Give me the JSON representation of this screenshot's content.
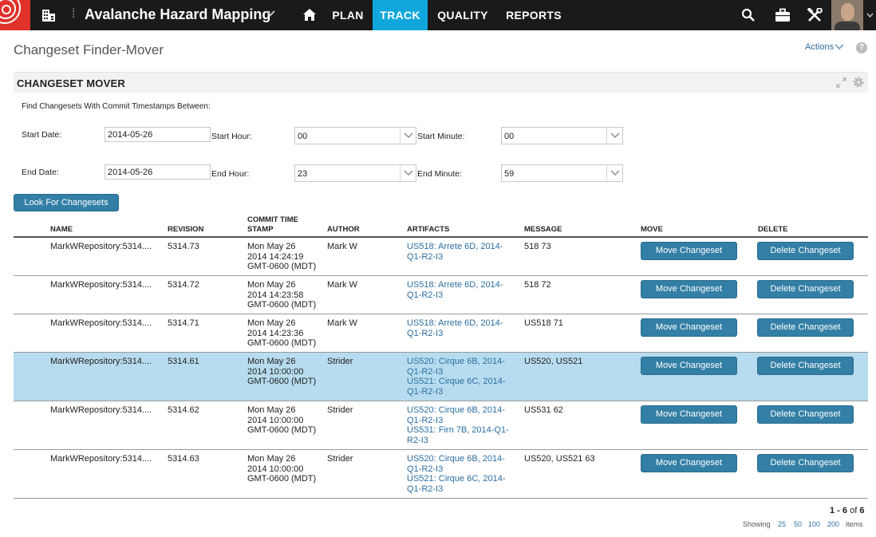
{
  "app": {
    "project_title": "Avalanche Hazard Mapping",
    "nav_tabs": [
      {
        "label": "PLAN",
        "active": false
      },
      {
        "label": "TRACK",
        "active": true
      },
      {
        "label": "QUALITY",
        "active": false
      },
      {
        "label": "REPORTS",
        "active": false
      }
    ],
    "colors": {
      "topbar": "#1a1a1a",
      "logo": "#e0312b",
      "active_tab": "#11a7dc",
      "button": "#337fa6",
      "link": "#2c6ea1",
      "selected_row": "#b7dcef"
    }
  },
  "page": {
    "title": "Changeset Finder-Mover",
    "actions_label": "Actions",
    "help_label": "?"
  },
  "panel": {
    "title": "CHANGESET MOVER",
    "find_label": "Find Changesets With Commit Timestamps Between:",
    "start_date_label": "Start Date:",
    "start_date": "2014-05-26",
    "start_hour_label": "Start Hour:",
    "start_hour": "00",
    "start_minute_label": "Start Minute:",
    "start_minute": "00",
    "end_date_label": "End Date:",
    "end_date": "2014-05-26",
    "end_hour_label": "End Hour:",
    "end_hour": "23",
    "end_minute_label": "End Minute:",
    "end_minute": "59",
    "look_button": "Look For Changesets"
  },
  "table": {
    "headers": {
      "name": "NAME",
      "revision": "REVISION",
      "commit_line1": "COMMIT TIME",
      "commit_line2": "STAMP",
      "author": "AUTHOR",
      "artifacts": "ARTIFACTS",
      "message": "MESSAGE",
      "move": "MOVE",
      "delete": "DELETE"
    },
    "move_label": "Move Changeset",
    "delete_label": "Delete Changeset",
    "rows": [
      {
        "name": "MarkWRepository:5314....",
        "revision": "5314.73",
        "ts1": "Mon May 26",
        "ts2": "2014 14:24:19",
        "ts3": "GMT-0600 (MDT)",
        "author": "Mark W",
        "artifacts": [
          "US518: Arrete 6D, 2014-",
          "Q1-R2-I3"
        ],
        "message": "518 73",
        "selected": false
      },
      {
        "name": "MarkWRepository:5314....",
        "revision": "5314.72",
        "ts1": "Mon May 26",
        "ts2": "2014 14:23:58",
        "ts3": "GMT-0600 (MDT)",
        "author": "Mark W",
        "artifacts": [
          "US518: Arrete 6D, 2014-",
          "Q1-R2-I3"
        ],
        "message": "518 72",
        "selected": false
      },
      {
        "name": "MarkWRepository:5314....",
        "revision": "5314.71",
        "ts1": "Mon May 26",
        "ts2": "2014 14:23:36",
        "ts3": "GMT-0600 (MDT)",
        "author": "Mark W",
        "artifacts": [
          "US518: Arrete 6D, 2014-",
          "Q1-R2-I3"
        ],
        "message": "US518 71",
        "selected": false
      },
      {
        "name": "MarkWRepository:5314....",
        "revision": "5314.61",
        "ts1": "Mon May 26",
        "ts2": "2014 10:00:00",
        "ts3": "GMT-0600 (MDT)",
        "author": "Strider",
        "artifacts": [
          "US520: Cirque 6B, 2014-",
          "Q1-R2-I3",
          "US521: Cirque 6C, 2014-",
          "Q1-R2-I3"
        ],
        "message": "US520, US521",
        "selected": true
      },
      {
        "name": "MarkWRepository:5314....",
        "revision": "5314.62",
        "ts1": "Mon May 26",
        "ts2": "2014 10:00:00",
        "ts3": "GMT-0600 (MDT)",
        "author": "Strider",
        "artifacts": [
          "US520: Cirque 6B, 2014-",
          "Q1-R2-I3",
          "US531: Firn 7B, 2014-Q1-",
          "R2-I3"
        ],
        "message": "US531 62",
        "selected": false
      },
      {
        "name": "MarkWRepository:5314....",
        "revision": "5314.63",
        "ts1": "Mon May 26",
        "ts2": "2014 10:00:00",
        "ts3": "GMT-0600 (MDT)",
        "author": "Strider",
        "artifacts": [
          "US520: Cirque 6B, 2014-",
          "Q1-R2-I3",
          "US521: Cirque 6C, 2014-",
          "Q1-R2-I3"
        ],
        "message": "US520, US521 63",
        "selected": false
      }
    ]
  },
  "pager": {
    "range": "1 - 6",
    "of_label": "of",
    "total": "6",
    "showing_label": "Showing",
    "page_sizes": [
      "25",
      "50",
      "100",
      "200"
    ],
    "items_label": "items"
  }
}
